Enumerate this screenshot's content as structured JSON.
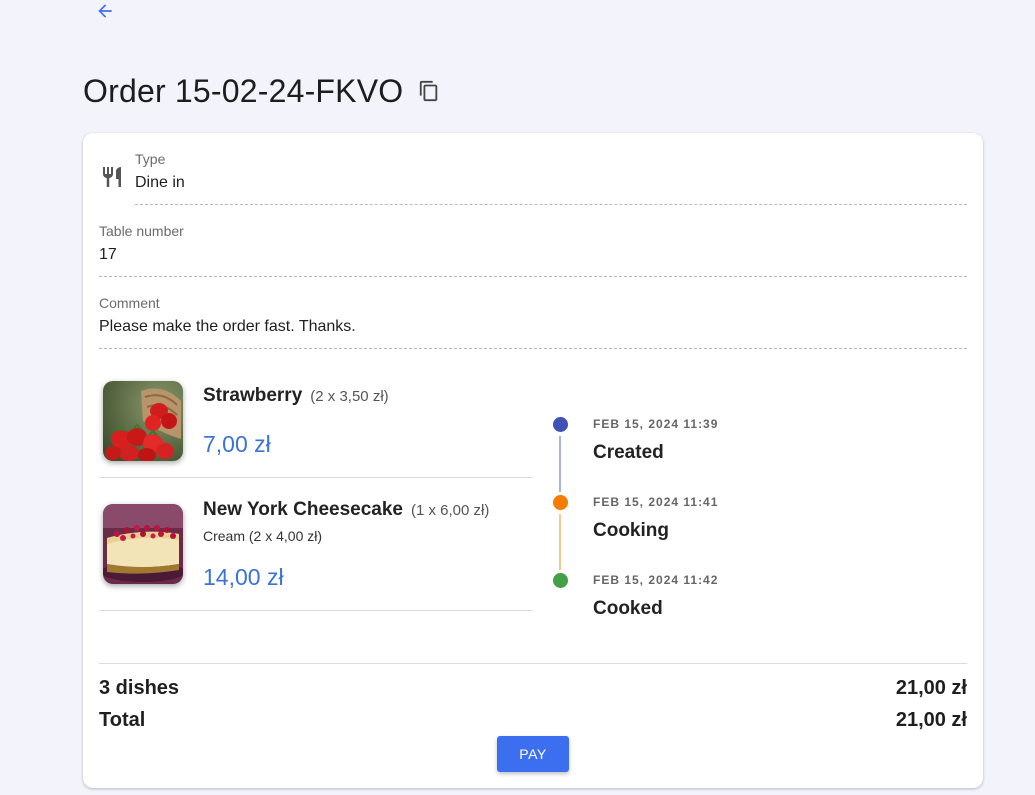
{
  "header": {
    "back_icon": "arrow-left-icon",
    "title": "Order 15-02-24-FKVO",
    "copy_icon": "copy-icon"
  },
  "details": {
    "type_icon": "fork-knife-icon",
    "type_label": "Type",
    "type_value": "Dine in",
    "table_label": "Table number",
    "table_value": "17",
    "comment_label": "Comment",
    "comment_value": "Please make the order fast. Thanks."
  },
  "items": [
    {
      "name": "Strawberry",
      "qty": "(2 x 3,50 zł)",
      "extra": "",
      "price": "7,00 zł",
      "image": "strawberries"
    },
    {
      "name": "New York Cheesecake",
      "qty": "(1 x 6,00 zł)",
      "extra": "Cream (2 x 4,00 zł)",
      "price": "14,00 zł",
      "image": "cheesecake"
    }
  ],
  "timeline": [
    {
      "date": "FEB 15, 2024 11:39",
      "status": "Created",
      "color": "#3f51b5"
    },
    {
      "date": "FEB 15, 2024 11:41",
      "status": "Cooking",
      "color": "#f57c00"
    },
    {
      "date": "FEB 15, 2024 11:42",
      "status": "Cooked",
      "color": "#43a047"
    }
  ],
  "summary": {
    "dishes_label": "3 dishes",
    "dishes_value": "21,00 zł",
    "total_label": "Total",
    "total_value": "21,00 zł",
    "pay_label": "PAY"
  },
  "colors": {
    "accent": "#3b6ff0",
    "price": "#3b74d8",
    "background": "#f2f3fb"
  }
}
